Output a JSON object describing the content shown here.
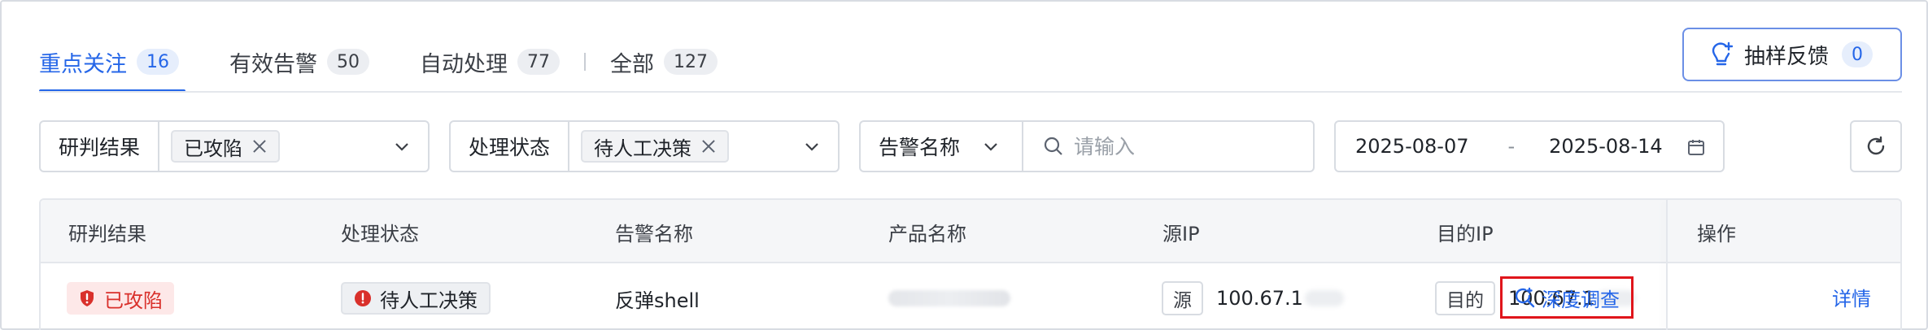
{
  "tabs": [
    {
      "label": "重点关注",
      "count": "16"
    },
    {
      "label": "有效告警",
      "count": "50"
    },
    {
      "label": "自动处理",
      "count": "77"
    },
    {
      "label": "全部",
      "count": "127"
    }
  ],
  "feedback": {
    "label": "抽样反馈",
    "count": "0",
    "icon": "lightbulb-icon"
  },
  "filters": {
    "verdict": {
      "label": "研判结果",
      "value": "已攻陷"
    },
    "status": {
      "label": "处理状态",
      "value": "待人工决策"
    },
    "alert_field": {
      "label": "告警名称"
    },
    "search": {
      "placeholder": "请输入"
    },
    "date_start": "2025-08-07",
    "date_sep": "-",
    "date_end": "2025-08-14"
  },
  "table": {
    "headers": [
      "研判结果",
      "处理状态",
      "告警名称",
      "产品名称",
      "源IP",
      "目的IP",
      "操作"
    ],
    "row": {
      "verdict": "已攻陷",
      "status": "待人工决策",
      "alert_name": "反弹shell",
      "src_prefix": "源",
      "src_ip": "100.67.1",
      "dst_prefix": "目的",
      "dst_ip": "100.67.1",
      "action_deep": "深度调查",
      "action_detail": "详情"
    }
  },
  "colors": {
    "accent": "#2566e8",
    "danger": "#d9302b",
    "highlight_border": "#e0151b"
  }
}
